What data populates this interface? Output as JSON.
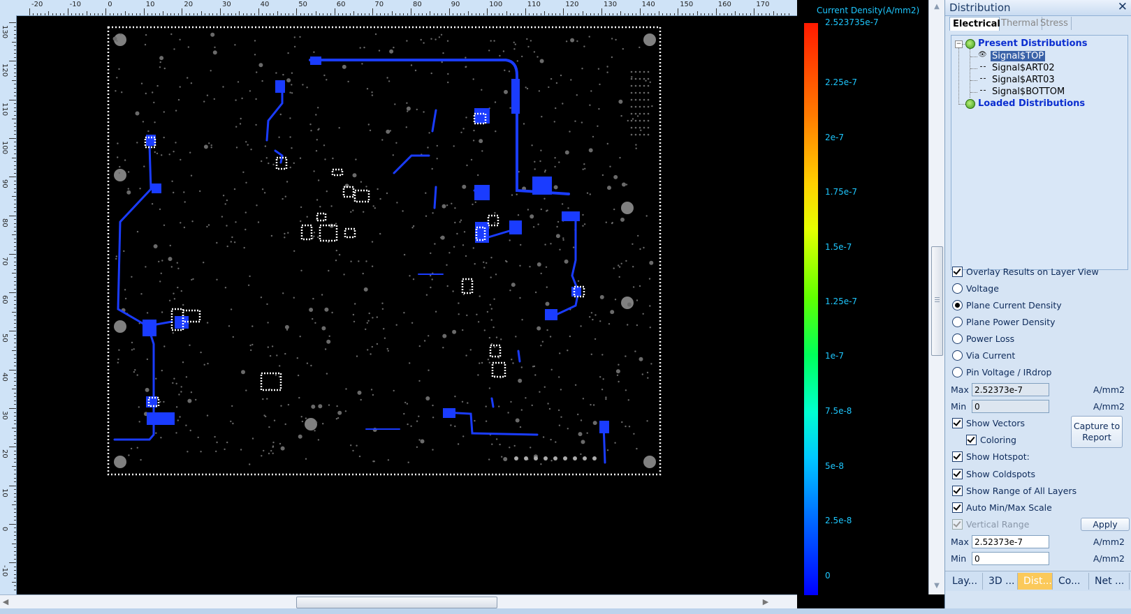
{
  "ruler": {
    "top_labels": [
      "-20",
      "-10",
      "0",
      "10",
      "20",
      "30",
      "40",
      "50",
      "60",
      "70",
      "80",
      "90",
      "100",
      "110",
      "120",
      "130",
      "140",
      "150",
      "160",
      "170"
    ],
    "left_labels": [
      "130",
      "120",
      "110",
      "100",
      "90",
      "80",
      "70",
      "60",
      "50",
      "40",
      "30",
      "20",
      "10",
      "0",
      "-10"
    ]
  },
  "legend": {
    "title": "Current Density(A/mm2)",
    "labels": [
      "2.523735e-7",
      "2.25e-7",
      "2e-7",
      "1.75e-7",
      "1.5e-7",
      "1.25e-7",
      "1e-7",
      "7.5e-8",
      "5e-8",
      "2.5e-8",
      "0"
    ],
    "top_color": "#ff1a00",
    "bottom_color": "#0000ff",
    "trace_color": "#1a3cff"
  },
  "panel": {
    "title": "Distribution",
    "close": "✕",
    "tabs": [
      "Electrical",
      "Thermal",
      "Stress"
    ],
    "active_tab": "Electrical",
    "tree": {
      "present_label": "Present Distributions",
      "items": [
        "Signal$TOP",
        "Signal$ART02",
        "Signal$ART03",
        "Signal$BOTTOM"
      ],
      "selected": "Signal$TOP",
      "loaded_label": "Loaded Distributions"
    },
    "overlay_label": "Overlay Results on Layer View",
    "radios": [
      "Voltage",
      "Plane Current Density",
      "Plane Power Density",
      "Power Loss",
      "Via Current",
      "Pin Voltage / IRdrop"
    ],
    "selected_radio": "Plane Current Density",
    "range1": {
      "max_label": "Max",
      "max_value": "2.52373e-7",
      "min_label": "Min",
      "min_value": "0",
      "unit": "A/mm2"
    },
    "show_vectors": "Show Vectors",
    "coloring": "Coloring",
    "capture_button": "Capture to Report",
    "show_hotspots": "Show Hotspot:",
    "show_coldspots": "Show Coldspots",
    "show_range": "Show Range of All Layers",
    "auto_minmax": "Auto Min/Max Scale",
    "vertical_range": "Vertical Range",
    "apply_button": "Apply",
    "range2": {
      "max_label": "Max",
      "max_value": "2.52373e-7",
      "min_label": "Min",
      "min_value": "0",
      "unit": "A/mm2"
    },
    "bottom_tabs": [
      "Lay...",
      "3D ...",
      "Dist...",
      "Co...",
      "Net ..."
    ],
    "active_bottom_tab": "Dist...",
    "accent": "#fbc95a"
  }
}
